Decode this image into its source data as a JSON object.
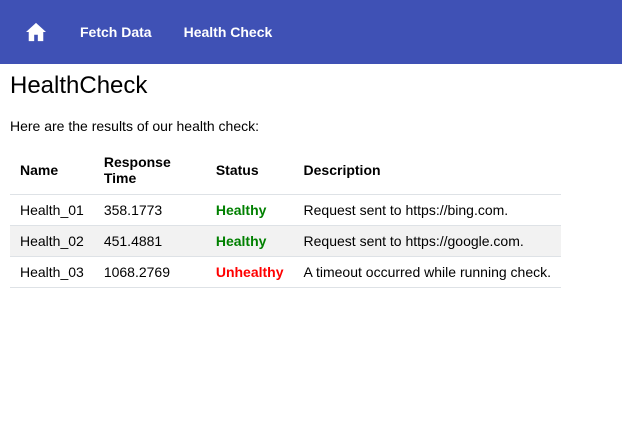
{
  "nav": {
    "home_icon": "home-icon",
    "links": [
      {
        "label": "Fetch Data"
      },
      {
        "label": "Health Check"
      }
    ]
  },
  "page": {
    "title": "HealthCheck",
    "intro": "Here are the results of our health check:"
  },
  "table": {
    "headers": [
      "Name",
      "Response Time",
      "Status",
      "Description"
    ],
    "rows": [
      {
        "name": "Health_01",
        "response_time": "358.1773",
        "status": "Healthy",
        "description": "Request sent to https://bing.com."
      },
      {
        "name": "Health_02",
        "response_time": "451.4881",
        "status": "Healthy",
        "description": "Request sent to https://google.com."
      },
      {
        "name": "Health_03",
        "response_time": "1068.2769",
        "status": "Unhealthy",
        "description": "A timeout occurred while running check."
      }
    ]
  },
  "colors": {
    "navbar": "#3f51b5",
    "healthy": "#008000",
    "unhealthy": "#ff0000"
  }
}
